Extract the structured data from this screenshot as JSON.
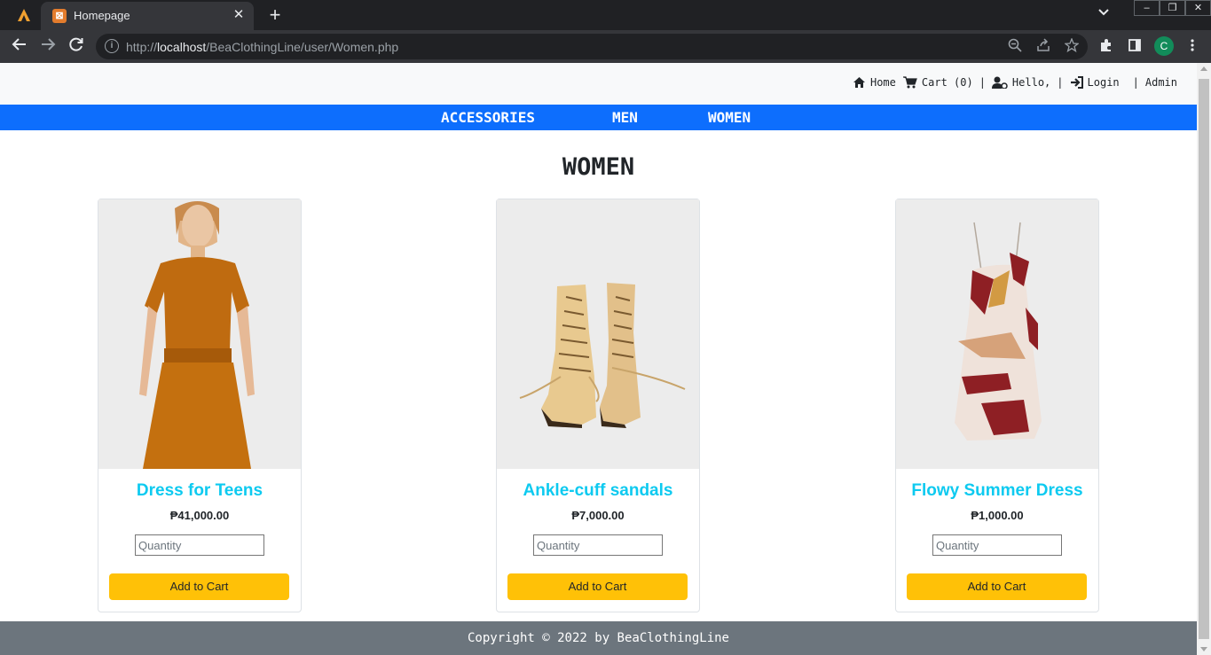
{
  "browser": {
    "tab_title": "Homepage",
    "tab_favicon_glyph": "⊠",
    "new_tab": "+",
    "close_tab": "✕",
    "url_host": "localhost",
    "url_prefix": "http://",
    "url_path": "/BeaClothingLine/user/Women.php",
    "profile_initial": "C",
    "window_controls": [
      "–",
      "❐",
      "✕"
    ]
  },
  "topnav": {
    "home": "Home",
    "cart": "Cart (0)",
    "hello": "Hello,",
    "login": "Login",
    "admin": "Admin",
    "separator": "|"
  },
  "categories": [
    "ACCESSORIES",
    "MEN",
    "WOMEN"
  ],
  "page_heading": "WOMEN",
  "products": [
    {
      "name": "Dress for Teens",
      "price": "₱41,000.00",
      "quantity_placeholder": "Quantity",
      "button": "Add to Cart"
    },
    {
      "name": "Ankle-cuff sandals",
      "price": "₱7,000.00",
      "quantity_placeholder": "Quantity",
      "button": "Add to Cart"
    },
    {
      "name": "Flowy Summer Dress",
      "price": "₱1,000.00",
      "quantity_placeholder": "Quantity",
      "button": "Add to Cart"
    }
  ],
  "footer": "Copyright © 2022 by BeaClothingLine",
  "colors": {
    "navbar": "#0d6efd",
    "product_title": "#0dcaf0",
    "button": "#ffc107",
    "footer": "#6c757d"
  }
}
